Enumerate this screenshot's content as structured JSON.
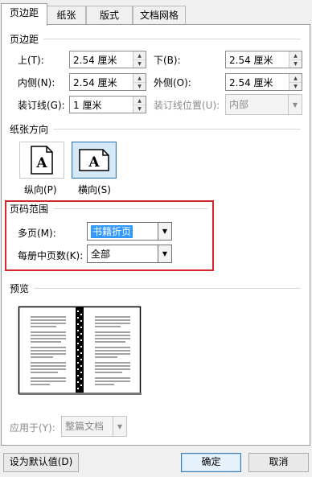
{
  "tabs": [
    {
      "label": "页边距",
      "active": true
    },
    {
      "label": "纸张",
      "active": false
    },
    {
      "label": "版式",
      "active": false
    },
    {
      "label": "文档网格",
      "active": false
    }
  ],
  "margins": {
    "title": "页边距",
    "top_label": "上(T):",
    "top_value": "2.54 厘米",
    "bottom_label": "下(B):",
    "bottom_value": "2.54 厘米",
    "inside_label": "内侧(N):",
    "inside_value": "2.54 厘米",
    "outside_label": "外侧(O):",
    "outside_value": "2.54 厘米",
    "gutter_label": "装订线(G):",
    "gutter_value": "1 厘米",
    "gutter_pos_label": "装订线位置(U):",
    "gutter_pos_value": "内部"
  },
  "orientation": {
    "title": "纸张方向",
    "portrait_label": "纵向(P)",
    "landscape_label": "横向(S)",
    "icon_letter": "A"
  },
  "pages": {
    "title": "页码范围",
    "multiple_label": "多页(M):",
    "multiple_value": "书籍折页",
    "sheets_label": "每册中页数(K):",
    "sheets_value": "全部"
  },
  "preview": {
    "title": "预览"
  },
  "apply": {
    "label": "应用于(Y):",
    "value": "整篇文档"
  },
  "buttons": {
    "default": "设为默认值(D)",
    "ok": "确定",
    "cancel": "取消"
  },
  "colors": {
    "highlight": "#d4262f",
    "selection": "#3399ff",
    "accent": "#3c7fb1"
  }
}
